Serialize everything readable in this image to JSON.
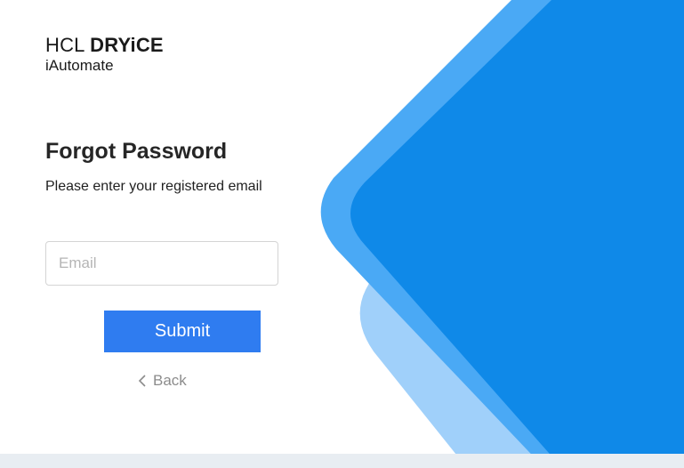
{
  "brand": {
    "company": "HCL",
    "product": "DRYiCE",
    "app_name": "iAutomate"
  },
  "form": {
    "title": "Forgot Password",
    "subtitle": "Please enter your registered email",
    "email_placeholder": "Email",
    "submit_label": "Submit",
    "back_label": "Back"
  },
  "colors": {
    "primary": "#2f7cf0",
    "shape_dark": "#0f89e8",
    "shape_mid": "#4aa9f5",
    "shape_light": "#a0d0fa",
    "footer": "#e8edf2"
  },
  "icons": {
    "back": "chevron-left-icon"
  }
}
